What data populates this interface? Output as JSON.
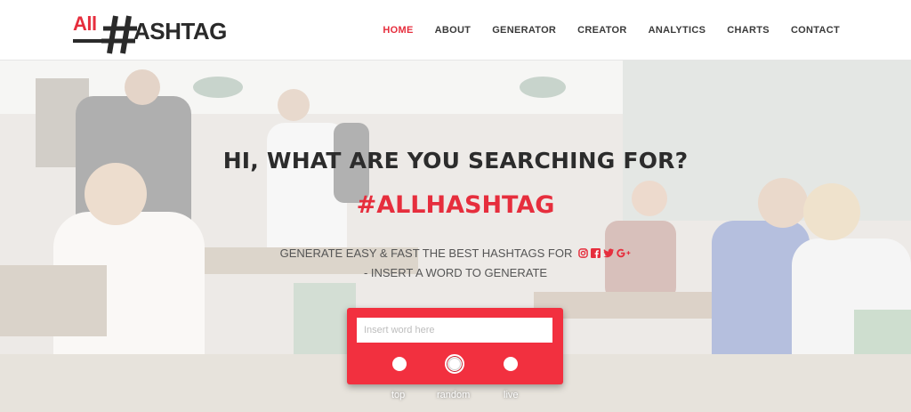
{
  "logo": {
    "part1": "All",
    "hash": "#",
    "part2": "ASHTAG"
  },
  "nav": [
    {
      "label": "HOME",
      "active": true
    },
    {
      "label": "ABOUT",
      "active": false
    },
    {
      "label": "GENERATOR",
      "active": false
    },
    {
      "label": "CREATOR",
      "active": false
    },
    {
      "label": "ANALYTICS",
      "active": false
    },
    {
      "label": "CHARTS",
      "active": false
    },
    {
      "label": "CONTACT",
      "active": false
    }
  ],
  "hero": {
    "title": "HI, WHAT ARE YOU SEARCHING FOR?",
    "brand": "#ALLHASHTAG",
    "line1": "GENERATE EASY & FAST THE BEST HASHTAGS FOR",
    "line2": "- INSERT A WORD TO GENERATE",
    "social_icons": [
      "instagram-icon",
      "facebook-icon",
      "twitter-icon",
      "google-plus-icon"
    ]
  },
  "search": {
    "placeholder": "Insert word here",
    "value": "",
    "options": [
      {
        "label": "top",
        "selected": false
      },
      {
        "label": "random",
        "selected": true
      },
      {
        "label": "live",
        "selected": false
      }
    ]
  },
  "colors": {
    "accent": "#e62e3d",
    "box": "#f2303f",
    "text": "#2c2c2c"
  }
}
